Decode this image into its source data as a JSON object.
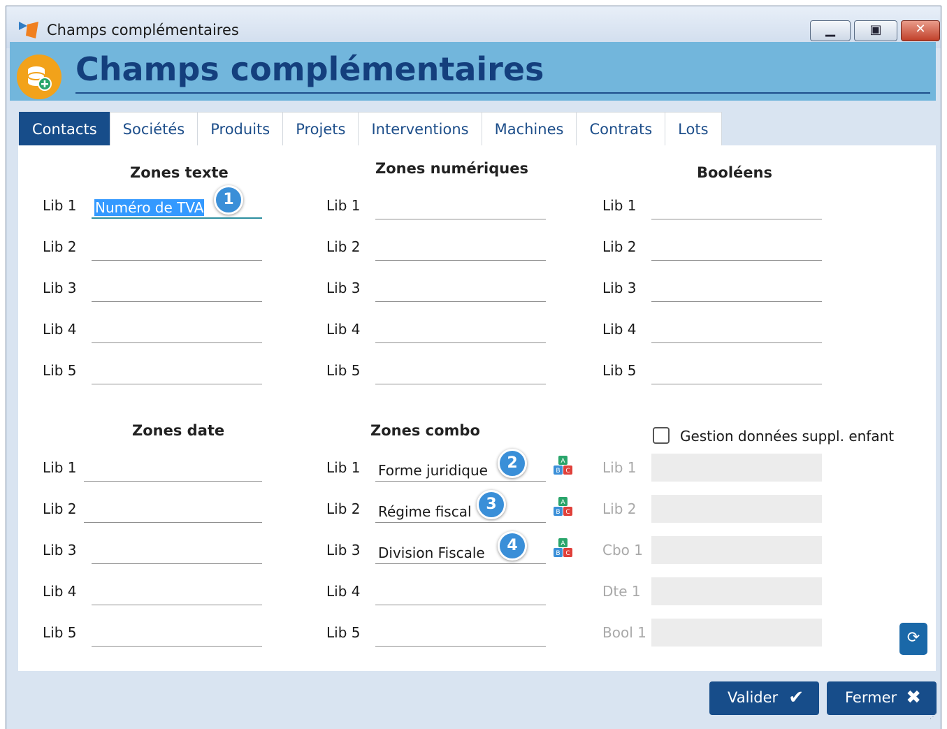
{
  "window": {
    "title": "Champs complémentaires"
  },
  "header": {
    "title": "Champs complémentaires"
  },
  "tabs": [
    "Contacts",
    "Sociétés",
    "Produits",
    "Projets",
    "Interventions",
    "Machines",
    "Contrats",
    "Lots"
  ],
  "active_tab": "Contacts",
  "sections": {
    "texte": {
      "title": "Zones texte",
      "rows": [
        {
          "label": "Lib 1",
          "value": "Numéro de TVA"
        },
        {
          "label": "Lib 2",
          "value": ""
        },
        {
          "label": "Lib 3",
          "value": ""
        },
        {
          "label": "Lib 4",
          "value": ""
        },
        {
          "label": "Lib 5",
          "value": ""
        }
      ]
    },
    "numeriques": {
      "title": "Zones numériques",
      "rows": [
        {
          "label": "Lib 1",
          "value": ""
        },
        {
          "label": "Lib 2",
          "value": ""
        },
        {
          "label": "Lib 3",
          "value": ""
        },
        {
          "label": "Lib 4",
          "value": ""
        },
        {
          "label": "Lib 5",
          "value": ""
        }
      ]
    },
    "booleens": {
      "title": "Booléens",
      "rows": [
        {
          "label": "Lib 1",
          "value": ""
        },
        {
          "label": "Lib 2",
          "value": ""
        },
        {
          "label": "Lib 3",
          "value": ""
        },
        {
          "label": "Lib 4",
          "value": ""
        },
        {
          "label": "Lib 5",
          "value": ""
        }
      ]
    },
    "date": {
      "title": "Zones date",
      "rows": [
        {
          "label": "Lib 1",
          "value": ""
        },
        {
          "label": "Lib 2",
          "value": ""
        },
        {
          "label": "Lib 3",
          "value": ""
        },
        {
          "label": "Lib 4",
          "value": ""
        },
        {
          "label": "Lib 5",
          "value": ""
        }
      ]
    },
    "combo": {
      "title": "Zones combo",
      "rows": [
        {
          "label": "Lib 1",
          "value": "Forme juridique"
        },
        {
          "label": "Lib 2",
          "value": "Régime fiscal"
        },
        {
          "label": "Lib 3",
          "value": "Division Fiscale"
        },
        {
          "label": "Lib 4",
          "value": ""
        },
        {
          "label": "Lib 5",
          "value": ""
        }
      ]
    },
    "enfant": {
      "checkbox_label": "Gestion données suppl. enfant",
      "checked": false,
      "rows": [
        {
          "label": "Lib 1",
          "value": ""
        },
        {
          "label": "Lib 2",
          "value": ""
        },
        {
          "label": "Cbo 1",
          "value": ""
        },
        {
          "label": "Dte 1",
          "value": ""
        },
        {
          "label": "Bool 1",
          "value": ""
        }
      ]
    }
  },
  "callouts": [
    "1",
    "2",
    "3",
    "4"
  ],
  "buttons": {
    "valider": "Valider",
    "fermer": "Fermer"
  },
  "icons": {
    "refresh": "refresh-icon",
    "check": "checkmark-icon",
    "close": "close-icon",
    "abc": "abc-blocks-icon"
  },
  "colors": {
    "header_bg": "#72b6dc",
    "title_blue": "#143f7d",
    "button_blue": "#174d8a",
    "callout_blue": "#3a8fd8"
  }
}
